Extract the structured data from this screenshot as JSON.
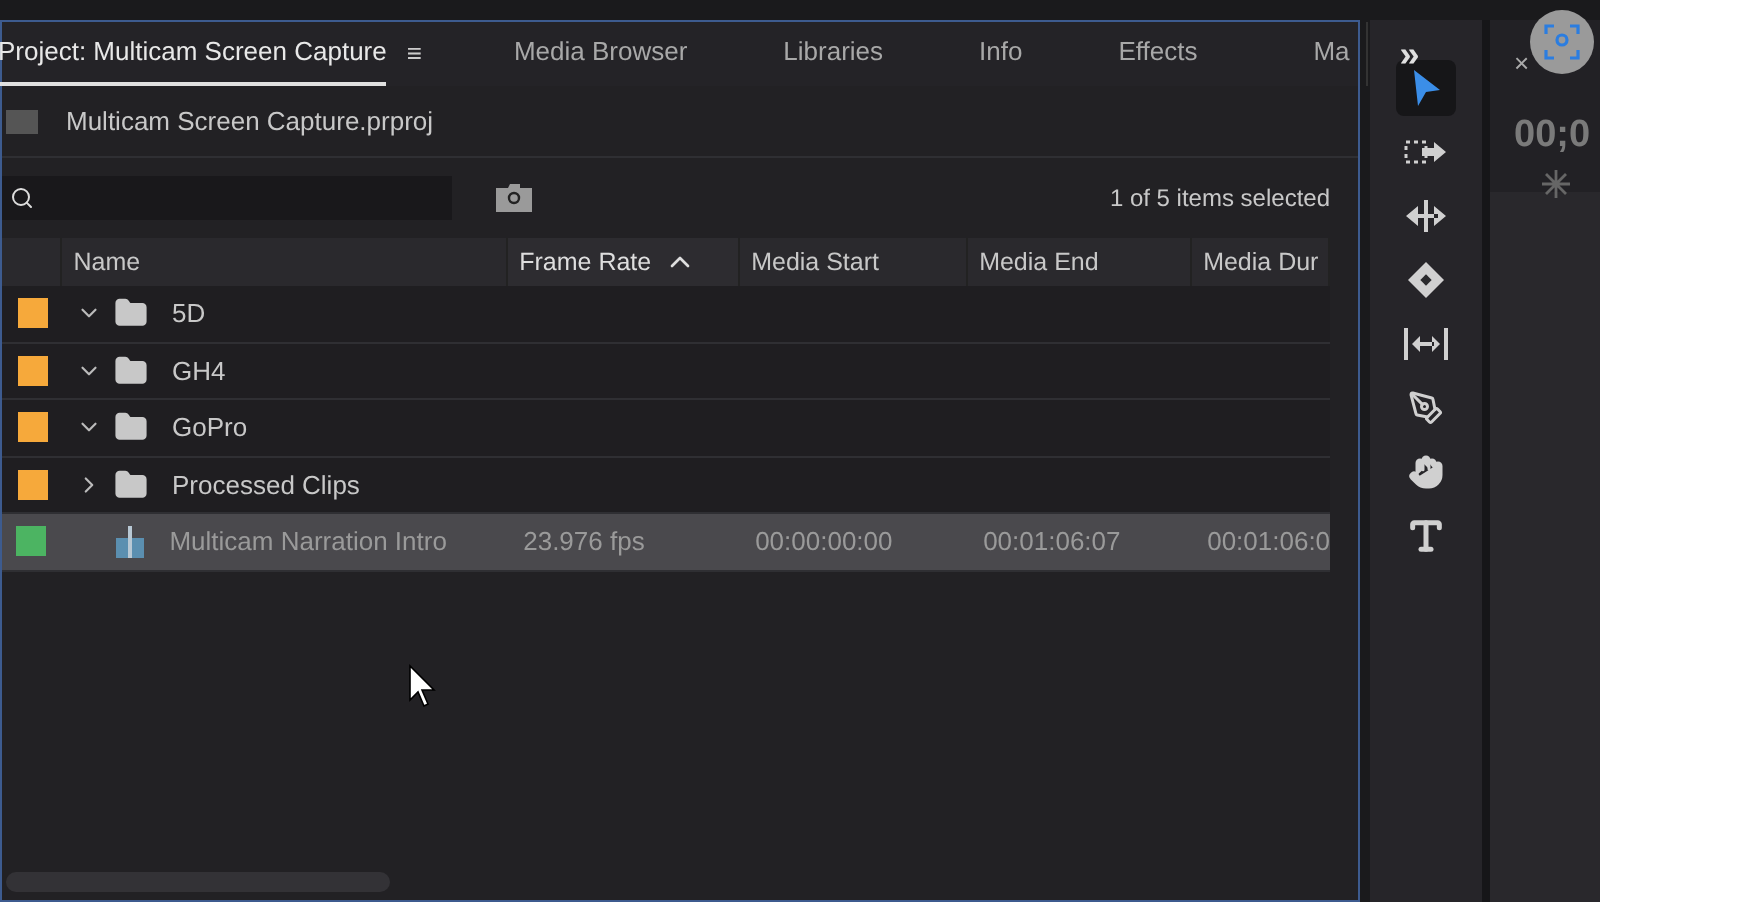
{
  "project_panel": {
    "tabs": [
      {
        "label": "Project: Multicam Screen Capture",
        "selected": true,
        "menu": "≡"
      },
      {
        "label": "Media Browser",
        "selected": false
      },
      {
        "label": "Libraries",
        "selected": false
      },
      {
        "label": "Info",
        "selected": false
      },
      {
        "label": "Effects",
        "selected": false
      },
      {
        "label": "Ma",
        "selected": false
      }
    ],
    "overflow": "»",
    "project_file": "Multicam Screen Capture.prproj",
    "selection_count": "1 of 5 items selected",
    "columns": [
      {
        "label": "Name",
        "sorted": false
      },
      {
        "label": "Frame Rate",
        "sorted": true
      },
      {
        "label": "Media Start",
        "sorted": false
      },
      {
        "label": "Media End",
        "sorted": false
      },
      {
        "label": "Media Dur",
        "sorted": false
      }
    ],
    "rows": [
      {
        "kind": "bin",
        "color": "#f6a93b",
        "expanded": true,
        "selected": false,
        "cells": [
          "5D"
        ]
      },
      {
        "kind": "bin",
        "color": "#f6a93b",
        "expanded": true,
        "selected": false,
        "cells": [
          "GH4"
        ]
      },
      {
        "kind": "bin",
        "color": "#f6a93b",
        "expanded": true,
        "selected": false,
        "cells": [
          "GoPro"
        ]
      },
      {
        "kind": "bin",
        "color": "#f6a93b",
        "expanded": false,
        "selected": false,
        "cells": [
          "Processed Clips"
        ]
      },
      {
        "kind": "sequence",
        "color": "#4cb462",
        "selected": true,
        "cells": [
          "Multicam Narration Intro",
          "23.976 fps",
          "00:00:00:00",
          "00:01:06:07",
          "00:01:06:0"
        ]
      }
    ]
  },
  "tools": [
    {
      "kind": "selection",
      "selected": true
    },
    {
      "kind": "track-select",
      "selected": false
    },
    {
      "kind": "ripple",
      "selected": false
    },
    {
      "kind": "razor",
      "selected": false
    },
    {
      "kind": "slip",
      "selected": false
    },
    {
      "kind": "pen",
      "selected": false
    },
    {
      "kind": "hand",
      "selected": false
    },
    {
      "kind": "type",
      "selected": false
    }
  ],
  "timeline_panel": {
    "close": "×",
    "timecode": "00;0"
  }
}
